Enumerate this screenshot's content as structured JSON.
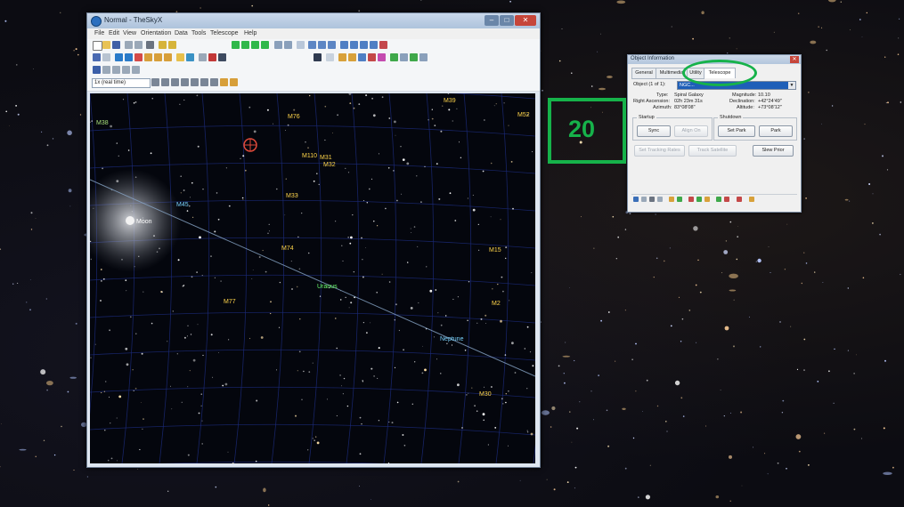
{
  "skyview_window": {
    "title": "Normal - TheSkyX",
    "menu": [
      "File",
      "Edit",
      "View",
      "Orientation",
      "Data",
      "Tools",
      "Telescope",
      "Help"
    ],
    "time_selector": "1x (real time)",
    "sky_labels": [
      {
        "text": "M39",
        "color": "#ffd54a"
      },
      {
        "text": "M52",
        "color": "#ffd54a"
      },
      {
        "text": "M76",
        "color": "#ffd54a"
      },
      {
        "text": "M38",
        "color": "#a8e07a"
      },
      {
        "text": "M110",
        "color": "#ffd54a"
      },
      {
        "text": "M31",
        "color": "#ffd54a"
      },
      {
        "text": "M32",
        "color": "#ffd54a"
      },
      {
        "text": "M33",
        "color": "#ffd54a"
      },
      {
        "text": "M45",
        "color": "#7ad4ff"
      },
      {
        "text": "Moon",
        "color": "#ffffff"
      },
      {
        "text": "M74",
        "color": "#ffd54a"
      },
      {
        "text": "M15",
        "color": "#ffd54a"
      },
      {
        "text": "Uranus",
        "color": "#6cff6c"
      },
      {
        "text": "M77",
        "color": "#ffd54a"
      },
      {
        "text": "M2",
        "color": "#ffd54a"
      },
      {
        "text": "Neptune",
        "color": "#7ad4ff"
      },
      {
        "text": "M30",
        "color": "#ffd54a"
      }
    ]
  },
  "object_info": {
    "title": "Object Information",
    "tabs": [
      "General",
      "Multimedia",
      "Utility",
      "Telescope"
    ],
    "object_label": "Object (1 of 1):",
    "object_value": "NGC...",
    "type_label": "Type:",
    "type_value": "Spiral Galaxy",
    "magnitude_label": "Magnitude:",
    "magnitude_value": "10.10",
    "ra_label": "Right Ascension:",
    "ra_value": "02h 23m 31s",
    "dec_label": "Declination:",
    "dec_value": "+42°24'49\"",
    "azimuth_label": "Azimuth:",
    "azimuth_value": "83°08'08\"",
    "altitude_label": "Altitude:",
    "altitude_value": "+73°08'12\"",
    "startup_label": "Startup",
    "shutdown_label": "Shutdown",
    "sync_label": "Sync",
    "align_label": "Align On",
    "set_park_label": "Set Park",
    "park_label": "Park",
    "set_tracking_label": "Set Tracking Rates",
    "track_satellite_label": "Track Satellite",
    "slew_prior_label": "Slew Prior"
  },
  "annotation": {
    "number": "20",
    "color": "#16b24a"
  }
}
